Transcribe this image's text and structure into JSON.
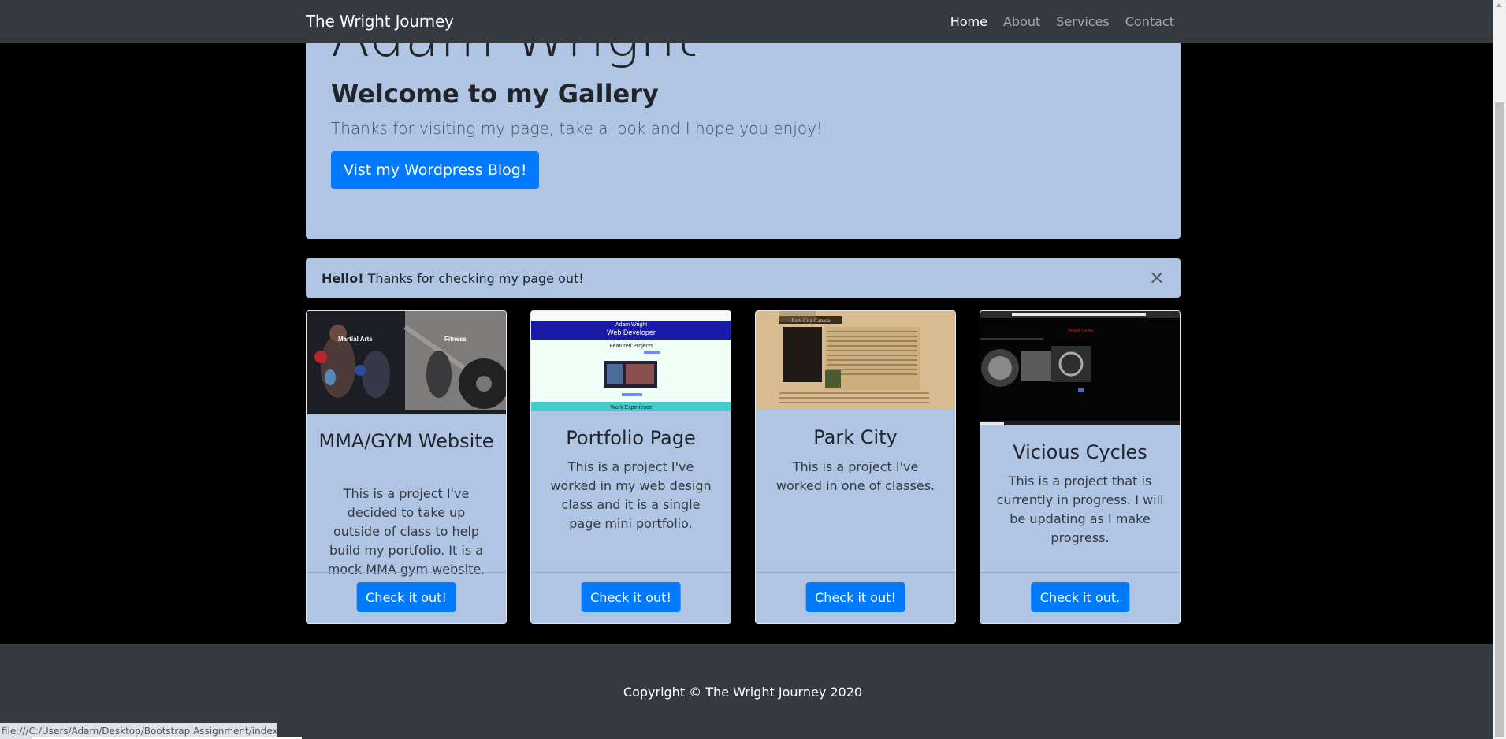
{
  "navbar": {
    "brand": "The Wright Journey",
    "links": [
      "Home",
      "About",
      "Services",
      "Contact"
    ],
    "active": "Home"
  },
  "jumbotron": {
    "name": "Adam Wright",
    "title": "Welcome to my Gallery",
    "lead": "Thanks for visiting my page, take a look and I hope you enjoy!",
    "button": "Vist my Wordpress Blog!"
  },
  "alert": {
    "strong": "Hello!",
    "text": " Thanks for checking my page out!",
    "close": "×"
  },
  "cards": [
    {
      "title": "MMA/GYM Website",
      "text": "This is a project I've decided to take up outside of class to help build my portfolio. It is a mock MMA gym website.",
      "button": "Check it out!",
      "image_labels": [
        "Martial Arts",
        "Fitness"
      ]
    },
    {
      "title": "Portfolio Page",
      "text": "This is a project I've worked in my web design class and it is a single page mini portfolio.",
      "button": "Check it out!",
      "image_labels": [
        "Adam Wright",
        "Web Developer",
        "Featured Projects",
        "Work Experience"
      ]
    },
    {
      "title": "Park City",
      "text": "This is a project I've worked in one of classes.",
      "button": "Check it out!",
      "image_labels": [
        "Park City Canada"
      ]
    },
    {
      "title": "Vicious Cycles",
      "text": "This is a project that is currently in progress. I will be updating as I make progress.",
      "button": "Check it out.",
      "image_labels": [
        "Vicious Cycles"
      ]
    }
  ],
  "footer": {
    "copyright": "Copyright © The Wright Journey 2020"
  },
  "statusbar": {
    "url": "file:///C:/Users/Adam/Desktop/Bootstrap Assignment/index.html#"
  },
  "colors": {
    "navbar_bg": "#343a40",
    "panel_bg": "#b0c4e4",
    "primary": "#007bff",
    "page_bg": "#000000"
  }
}
